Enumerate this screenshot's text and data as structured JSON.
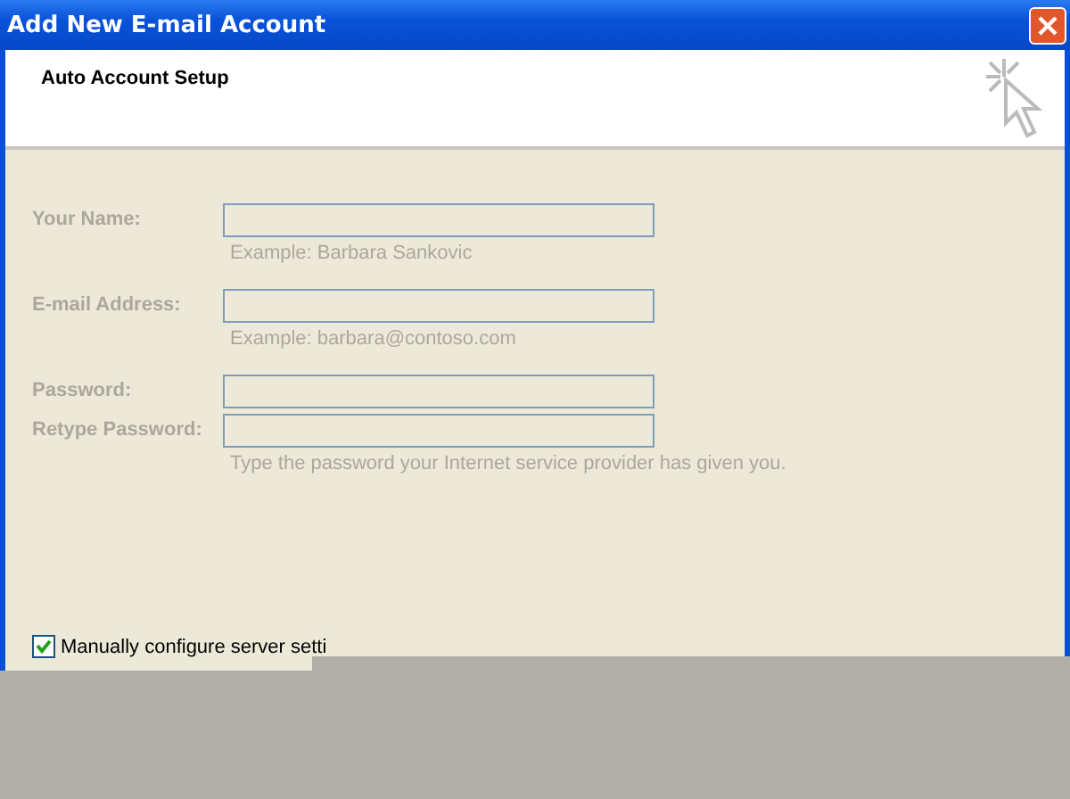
{
  "window": {
    "title": "Add New E-mail Account"
  },
  "header": {
    "title": "Auto Account Setup"
  },
  "fields": [
    {
      "label": "Your Name:",
      "hint": "Example: Barbara Sankovic",
      "disabled": true
    },
    {
      "label": "E-mail Address:",
      "hint": "Example: barbara@contoso.com",
      "disabled": true
    },
    {
      "label": "Password:",
      "disabled": true
    },
    {
      "label": "Retype Password:",
      "hint": "Type the password your Internet service provider has given you.",
      "disabled": true
    }
  ],
  "manual_option": {
    "label": "Manually configure server setti",
    "checked": true
  }
}
